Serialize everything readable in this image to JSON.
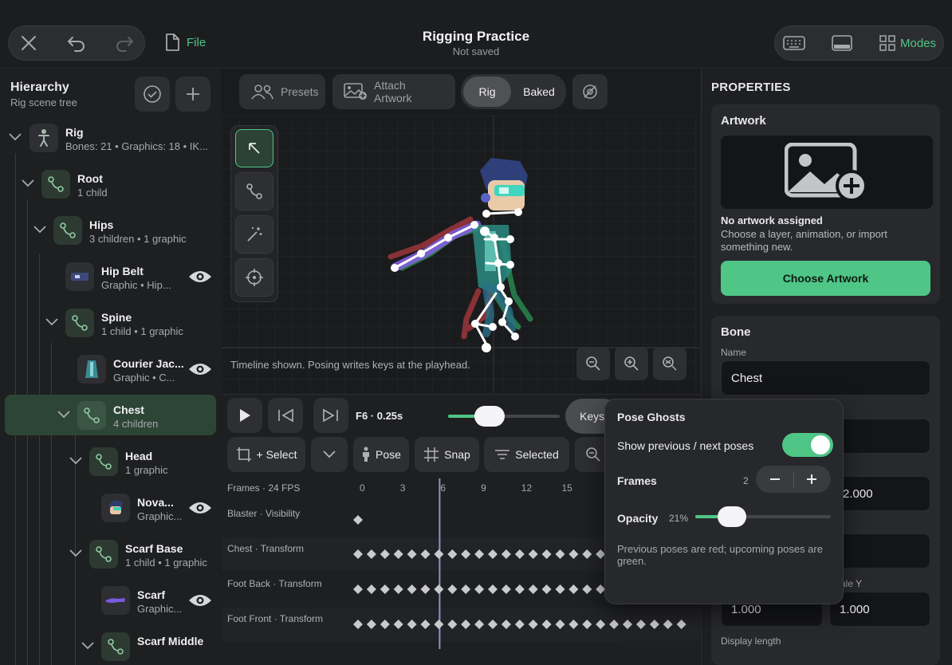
{
  "app": {
    "title": "Rigging Practice",
    "status": "Not saved",
    "file_label": "File",
    "modes_label": "Modes",
    "accent": "#4fc586"
  },
  "toolbar": {
    "presets": "Presets",
    "attach_artwork": "Attach Artwork",
    "rig": "Rig",
    "baked": "Baked"
  },
  "hierarchy": {
    "title": "Hierarchy",
    "subtitle": "Rig scene tree",
    "rows": [
      {
        "name": "Rig",
        "sub": "Bones: 21  •  Graphics: 18  •  IK..."
      },
      {
        "name": "Root",
        "sub": "1 child"
      },
      {
        "name": "Hips",
        "sub": "3 children  •  1 graphic"
      },
      {
        "name": "Hip Belt",
        "sub": "Graphic  •  Hip..."
      },
      {
        "name": "Spine",
        "sub": "1 child  •  1 graphic"
      },
      {
        "name": "Courier Jac...",
        "sub": "Graphic  •  C..."
      },
      {
        "name": "Chest",
        "sub": "4 children"
      },
      {
        "name": "Head",
        "sub": "1 graphic"
      },
      {
        "name": "Nova...",
        "sub": "Graphic..."
      },
      {
        "name": "Scarf Base",
        "sub": "1 child  •  1 graphic"
      },
      {
        "name": "Scarf",
        "sub": "Graphic..."
      },
      {
        "name": "Scarf Middle",
        "sub": ""
      }
    ]
  },
  "viewport": {
    "hint": "Timeline shown. Posing writes keys at the playhead."
  },
  "timeline": {
    "frame_readout": "F6 · 0.25s",
    "scrub_fraction": 0.32,
    "keys_label": "Keys",
    "select_label": "+ Select",
    "pose_label": "Pose",
    "snap_label": "Snap",
    "selected_label": "Selected",
    "header": "Frames · 24 FPS",
    "frame_ticks": [
      "0",
      "3",
      "6",
      "9",
      "12",
      "15"
    ],
    "playhead_frame": 6,
    "tracks": [
      {
        "name": "Blaster · Visibility",
        "keys": [
          0
        ]
      },
      {
        "name": "Chest · Transform",
        "keys": [
          0,
          1,
          2,
          3,
          4,
          5,
          6,
          7,
          8,
          9,
          10,
          11,
          12,
          13,
          14,
          15,
          16,
          17,
          18,
          19,
          20,
          21,
          22,
          23,
          24
        ]
      },
      {
        "name": "Foot Back · Transform",
        "keys": [
          0,
          1,
          2,
          3,
          4,
          5,
          6,
          7,
          8,
          9,
          10,
          11,
          12,
          13,
          14,
          15,
          16,
          17,
          18,
          19,
          20,
          21,
          22,
          23,
          24
        ]
      },
      {
        "name": "Foot Front · Transform",
        "keys": [
          0,
          1,
          2,
          3,
          4,
          5,
          6,
          7,
          8,
          9,
          10,
          11,
          12,
          13,
          14,
          15,
          16,
          17,
          18,
          19,
          20,
          21,
          22,
          23,
          24
        ]
      }
    ]
  },
  "properties": {
    "title": "PROPERTIES",
    "artwork": {
      "heading": "Artwork",
      "none_title": "No artwork assigned",
      "none_desc": "Choose a layer, animation, or import something new.",
      "button": "Choose Artwork"
    },
    "bone": {
      "heading": "Bone",
      "name_label": "Name",
      "name_value": "Chest",
      "field2_partial": "e",
      "field3_partial": "2.000",
      "scale_y_label_partial": "ale Y",
      "scale_x_value": "1.000",
      "scale_y_value": "1.000",
      "display_length_label": "Display length"
    }
  },
  "pose_ghosts": {
    "title": "Pose Ghosts",
    "show_label": "Show previous / next poses",
    "show_on": true,
    "frames_label": "Frames",
    "frames_value": "2",
    "opacity_label": "Opacity",
    "opacity_value": "21%",
    "opacity_fraction": 0.21,
    "note": "Previous poses are red; upcoming poses are green."
  }
}
